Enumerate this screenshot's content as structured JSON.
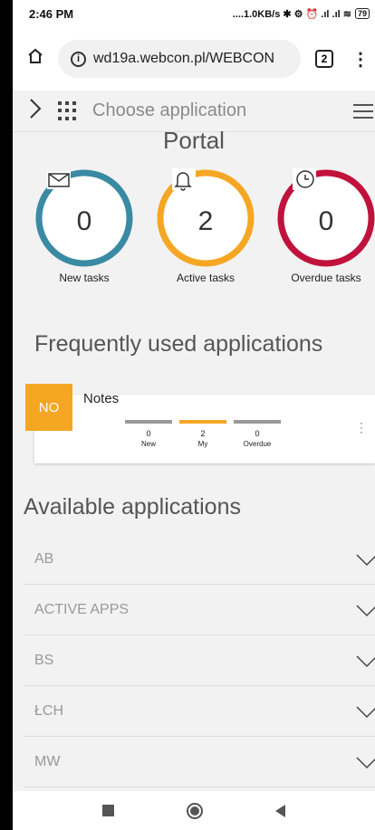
{
  "status_bar": {
    "time": "2:46 PM",
    "indicators": "....1.0KB/s ✱ ⚙ ⏰ .ıl .ıl ≋",
    "battery": "79"
  },
  "browser": {
    "url": "wd19a.webcon.pl/WEBCON",
    "tab_count": "2"
  },
  "app_header": {
    "choose_label": "Choose application"
  },
  "portal": {
    "title": "Portal",
    "stats": [
      {
        "count": "0",
        "label": "New tasks",
        "color": "#3a8aa3",
        "icon": "envelope-icon"
      },
      {
        "count": "2",
        "label": "Active tasks",
        "color": "#f5a623",
        "icon": "bell-icon"
      },
      {
        "count": "0",
        "label": "Overdue tasks",
        "color": "#c0123c",
        "icon": "clock-icon"
      }
    ]
  },
  "frequent": {
    "title": "Frequently used applications",
    "app": {
      "badge": "NO",
      "name": "Notes",
      "counters": [
        {
          "value": "0",
          "label": "New"
        },
        {
          "value": "2",
          "label": "My"
        },
        {
          "value": "0",
          "label": "Overdue"
        }
      ],
      "more": "⋮"
    }
  },
  "available": {
    "title": "Available applications",
    "apps": [
      "AB",
      "ACTIVE APPS",
      "BS",
      "ŁCH",
      "MW"
    ]
  },
  "colors": {
    "accent_orange": "#f5a623",
    "teal": "#3a8aa3",
    "crimson": "#c0123c"
  }
}
